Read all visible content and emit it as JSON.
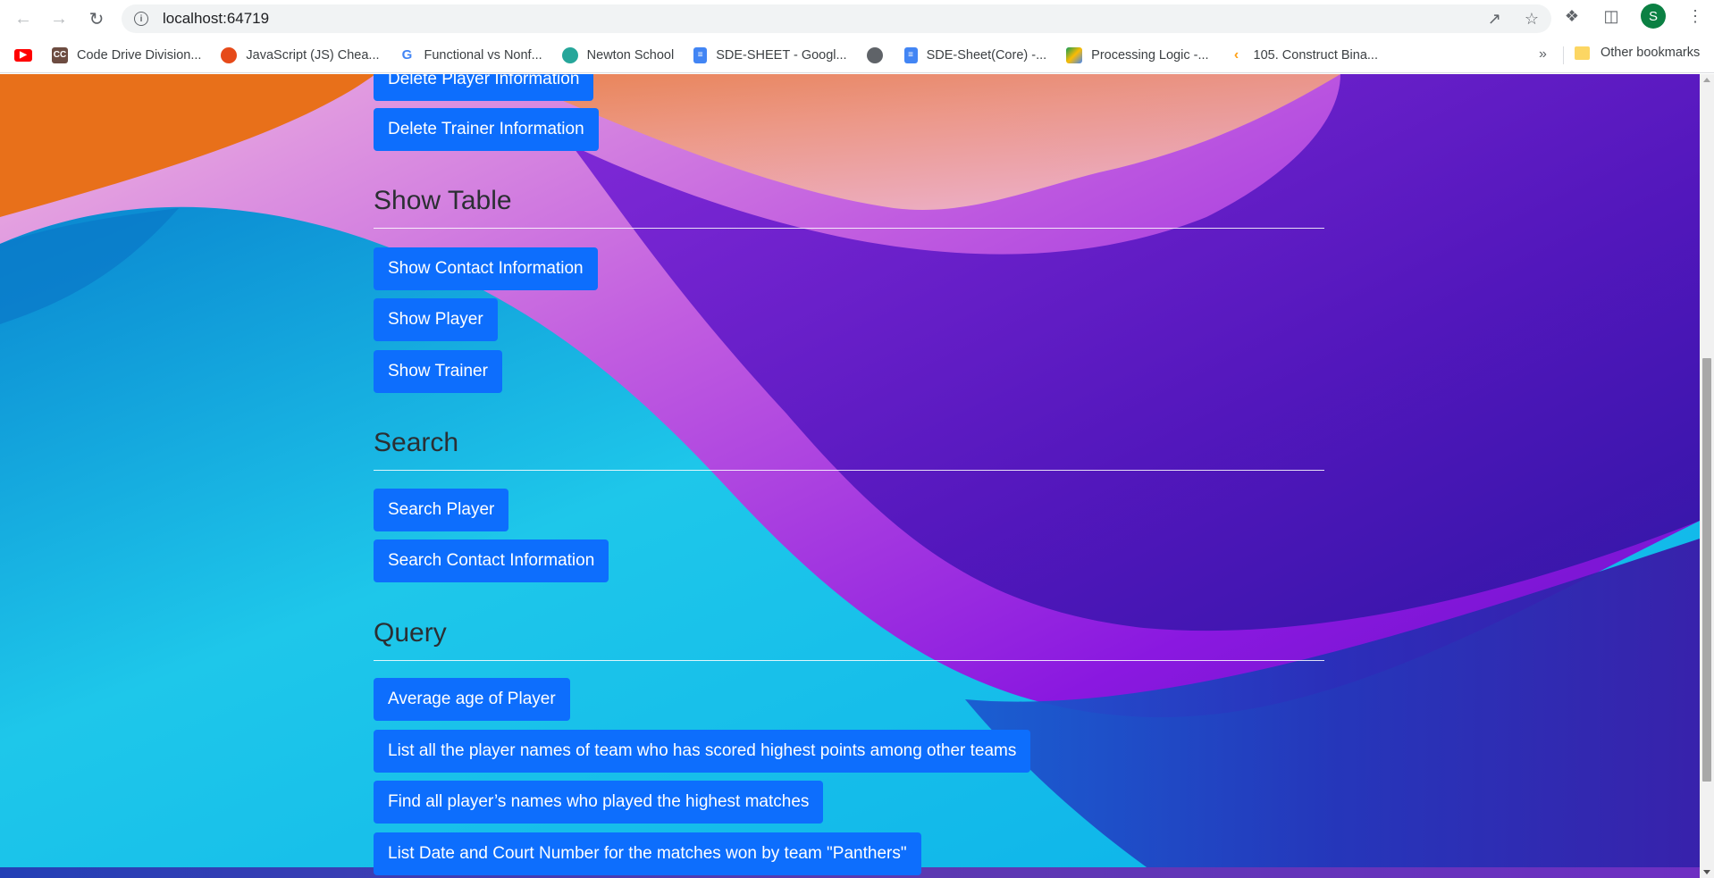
{
  "browser": {
    "url": "localhost:64719",
    "profile_initial": "S",
    "bookmarks": [
      {
        "label": "",
        "icon": "youtube-icon",
        "color": "#ff0000"
      },
      {
        "label": "Code Drive Division...",
        "icon": "cc-icon",
        "color": "#6d4c41"
      },
      {
        "label": "JavaScript (JS) Chea...",
        "icon": "js-cheatsheet-icon",
        "color": "#e64a19"
      },
      {
        "label": "Functional vs Nonf...",
        "icon": "google-icon",
        "color": "#4285f4"
      },
      {
        "label": "Newton School",
        "icon": "newton-icon",
        "color": "#26a69a"
      },
      {
        "label": "SDE-SHEET - Googl...",
        "icon": "docs-icon",
        "color": "#4285f4"
      },
      {
        "label": "",
        "icon": "globe-icon",
        "color": "#5f6368"
      },
      {
        "label": "SDE-Sheet(Core) -...",
        "icon": "docs-icon",
        "color": "#4285f4"
      },
      {
        "label": "Processing Logic -...",
        "icon": "drive-icon",
        "color": "#fbbc04"
      },
      {
        "label": "105. Construct Bina...",
        "icon": "leetcode-icon",
        "color": "#ffa116"
      }
    ],
    "more": "»",
    "other_bookmarks": "Other bookmarks"
  },
  "page": {
    "delete_buttons": [
      "Delete Player Information",
      "Delete Trainer Information"
    ],
    "show_table": {
      "heading": "Show Table",
      "buttons": [
        "Show Contact Information",
        "Show Player",
        "Show Trainer"
      ]
    },
    "search": {
      "heading": "Search",
      "buttons": [
        "Search Player",
        "Search Contact Information"
      ]
    },
    "query": {
      "heading": "Query",
      "buttons": [
        "Average age of Player",
        "List all the player names of team who has scored highest points among other teams",
        "Find all player’s names who played the highest matches",
        "List Date and Court Number for the matches won by team \"Panthers\""
      ]
    }
  },
  "colors": {
    "button_bg": "#0d6efd",
    "heading_text": "#2b2f33"
  }
}
